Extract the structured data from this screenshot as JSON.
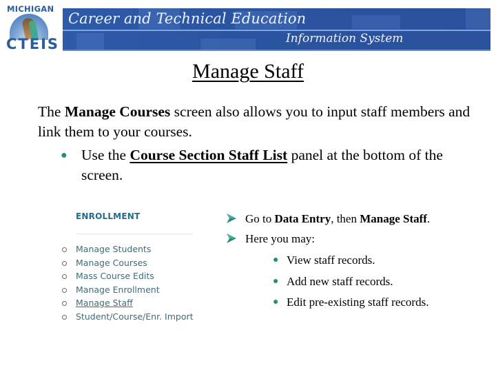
{
  "header": {
    "logo": {
      "top_text": "MICHIGAN",
      "bottom_text": "CTEIS"
    },
    "banner": {
      "title": "Career and Technical Education",
      "subtitle": "Information System"
    }
  },
  "page": {
    "title": "Manage Staff",
    "intro": {
      "prefix": "The ",
      "bold": "Manage Courses",
      "suffix": " screen also allows you to input staff members and link them to your courses."
    },
    "bullet": {
      "prefix": "Use the ",
      "bold_link": "Course Section Staff List",
      "suffix": " panel at the bottom of the screen."
    }
  },
  "enrollment_panel": {
    "heading": "ENROLLMENT",
    "items": [
      {
        "label": "Manage Students",
        "active": false
      },
      {
        "label": "Manage Courses",
        "active": false
      },
      {
        "label": "Mass Course Edits",
        "active": false
      },
      {
        "label": "Manage Enrollment",
        "active": false
      },
      {
        "label": "Manage Staff",
        "active": true
      },
      {
        "label": "Student/Course/Enr. Import",
        "active": false
      }
    ]
  },
  "steps": {
    "step1": {
      "prefix": "Go to ",
      "bold1": "Data Entry",
      "middle": ", then ",
      "bold2": "Manage Staff",
      "suffix": "."
    },
    "step2": {
      "text": "Here you may:"
    },
    "sub_steps": [
      "View staff records.",
      "Add new staff records.",
      "Edit pre-existing staff records."
    ]
  },
  "colors": {
    "banner_blue": "#2b54a0",
    "accent_teal": "#2a8a7a",
    "enrollment_heading": "#1f6d8c",
    "enrollment_link": "#3e6b77"
  }
}
